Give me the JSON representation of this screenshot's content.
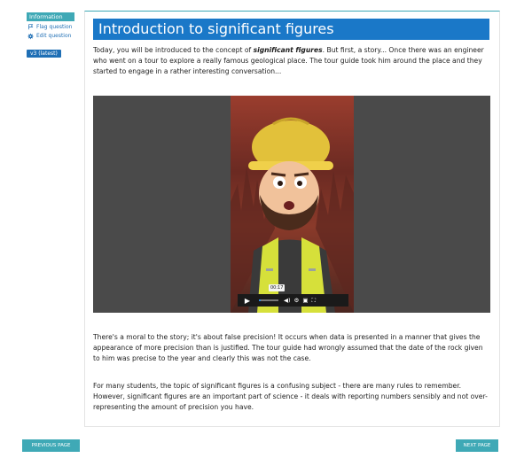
{
  "sidebar": {
    "info_label": "Information",
    "flag_label": "Flag question",
    "edit_label": "Edit question",
    "version_label": "v3 (latest)"
  },
  "content": {
    "title": "Introduction to significant figures",
    "intro_part1": "Today, you will be introduced to the concept of ",
    "intro_bold": "significant figures",
    "intro_part2": ". But first, a story... Once there was an engineer who went on a tour to explore a really famous geological place. The tour guide took him around the place and they started to engage in a rather interesting conversation...",
    "paragraph2": "There's a moral to the story; it's about false precision! It occurs when data is presented in a manner that gives the appearance of more precision than is justified. The tour guide had wrongly assumed that the date of the rock given to him was precise to the year and clearly this was not the case.",
    "paragraph3": "For many students, the topic of significant figures is a confusing subject - there are many rules to remember. However, significant figures are an important part of science - it deals with reporting numbers sensibly and not over-representing the amount of precision you have."
  },
  "video": {
    "time": "00:17",
    "progress_fraction": 0.1
  },
  "footer": {
    "prev_label": "PREVIOUS PAGE",
    "next_label": "NEXT PAGE"
  },
  "colors": {
    "accent": "#3fa9b6",
    "title_bg": "#1a78c8",
    "link": "#1f6fb5"
  }
}
